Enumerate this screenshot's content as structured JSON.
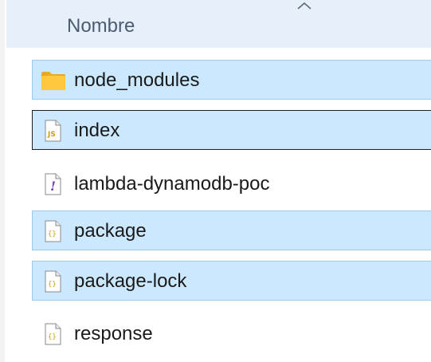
{
  "column_header": {
    "label": "Nombre",
    "sort_icon": "chevron-up-icon"
  },
  "files": [
    {
      "name": "node_modules",
      "icon": "folder-icon",
      "state": "selected"
    },
    {
      "name": "index",
      "icon": "js-file-icon",
      "state": "focused"
    },
    {
      "name": "lambda-dynamodb-poc",
      "icon": "exclamation-file-icon",
      "state": "normal"
    },
    {
      "name": "package",
      "icon": "json-file-icon",
      "state": "selected"
    },
    {
      "name": "package-lock",
      "icon": "json-file-icon",
      "state": "selected"
    },
    {
      "name": "response",
      "icon": "json-file-icon",
      "state": "normal"
    }
  ],
  "colors": {
    "selection_fill": "#cce8ff",
    "selection_border": "#99c9ef",
    "focus_border": "#1e1e1e",
    "header_bg": "#e5f0fa",
    "folder": "#ffc83d"
  }
}
